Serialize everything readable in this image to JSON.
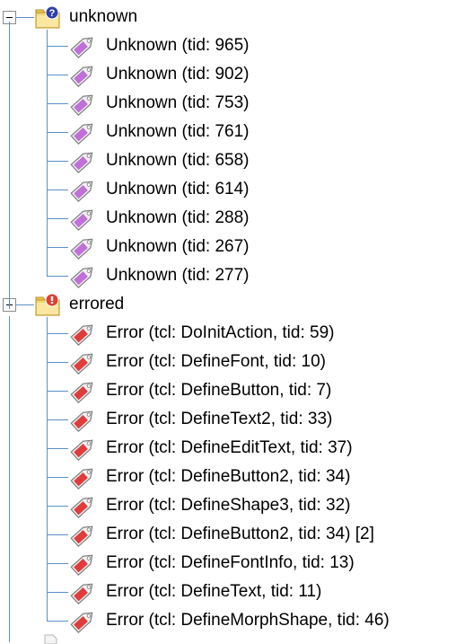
{
  "tree": {
    "groups": [
      {
        "label": "unknown",
        "icon": "folder-unknown-icon",
        "toggle": "minus",
        "tag_color": "#c070d8",
        "items": [
          "Unknown (tid: 965)",
          "Unknown (tid: 902)",
          "Unknown (tid: 753)",
          "Unknown (tid: 761)",
          "Unknown (tid: 658)",
          "Unknown (tid: 614)",
          "Unknown (tid: 288)",
          "Unknown (tid: 267)",
          "Unknown (tid: 277)"
        ]
      },
      {
        "label": "errored",
        "icon": "folder-error-icon",
        "toggle": "minus",
        "tag_color": "#e03c3c",
        "items": [
          "Error (tcl: DoInitAction, tid: 59)",
          "Error (tcl: DefineFont, tid: 10)",
          "Error (tcl: DefineButton, tid: 7)",
          "Error (tcl: DefineText2, tid: 33)",
          "Error (tcl: DefineEditText, tid: 37)",
          "Error (tcl: DefineButton2, tid: 34)",
          "Error (tcl: DefineShape3, tid: 32)",
          "Error (tcl: DefineButton2, tid: 34) [2]",
          "Error (tcl: DefineFontInfo, tid: 13)",
          "Error (tcl: DefineText, tid: 11)",
          "Error (tcl: DefineMorphShape, tid: 46)"
        ]
      }
    ],
    "line_color": "#5a8fc8"
  }
}
